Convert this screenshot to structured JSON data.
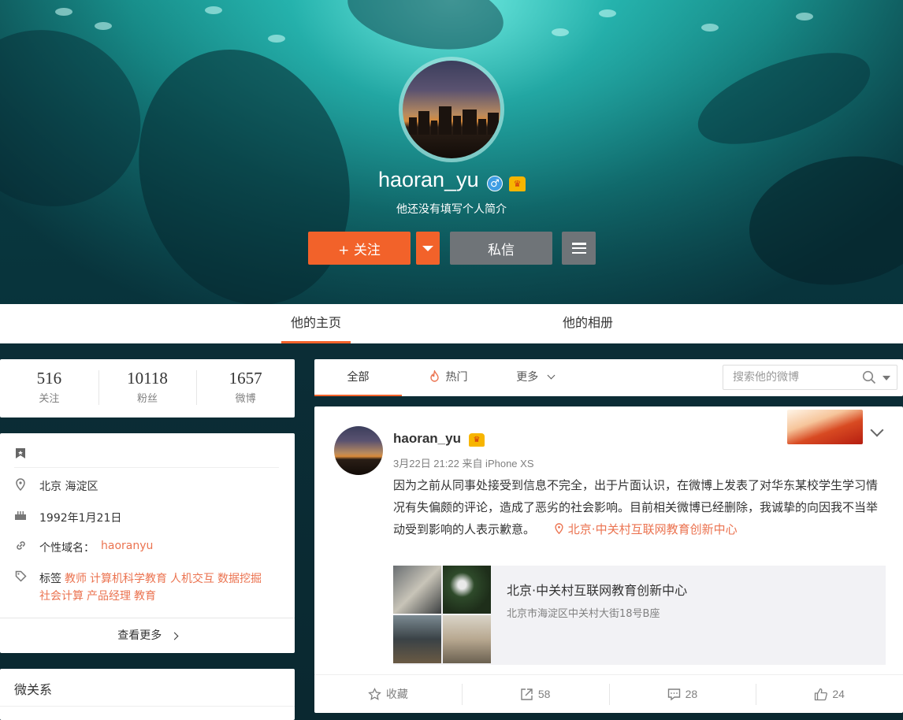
{
  "profile": {
    "username": "haoran_yu",
    "gender_icon": "male-icon",
    "vip_icon": "vip-crown-icon",
    "bio": "他还没有填写个人简介",
    "follow_label": "+ 关注",
    "message_label": "私信"
  },
  "main_tabs": [
    {
      "label": "他的主页",
      "active": true
    },
    {
      "label": "他的相册",
      "active": false
    }
  ],
  "stats": [
    {
      "value": "516",
      "label": "关注"
    },
    {
      "value": "10118",
      "label": "粉丝"
    },
    {
      "value": "1657",
      "label": "微博"
    }
  ],
  "info": {
    "location": "北京 海淀区",
    "birthday": "1992年1月21日",
    "domain_label": "个性域名：",
    "domain_value": "haoranyu",
    "tags_label": "标签",
    "tags": [
      "教师",
      "计算机科学教育",
      "人机交互",
      "数据挖掘",
      "社会计算",
      "产品经理",
      "教育"
    ],
    "more_label": "查看更多"
  },
  "relations": {
    "title": "微关系"
  },
  "feed_tabs": {
    "all": "全部",
    "hot": "热门",
    "more": "更多",
    "search_placeholder": "搜索他的微博"
  },
  "post": {
    "author": "haoran_yu",
    "meta": "3月22日 21:22 来自 iPhone XS",
    "text": "因为之前从同事处接受到信息不完全，出于片面认识，在微博上发表了对华东某校学生学习情况有失偏颇的评论，造成了恶劣的社会影响。目前相关微博已经删除，我诚挚的向因我不当举动受到影响的人表示歉意。",
    "location_tag": "北京·中关村互联网教育创新中心",
    "place": {
      "name": "北京·中关村互联网教育创新中心",
      "address": "北京市海淀区中关村大街18号B座"
    },
    "actions": {
      "favorite": "收藏",
      "repost": "58",
      "comment": "28",
      "like": "24"
    }
  },
  "colors": {
    "accent": "#f2622a",
    "link": "#eb7350",
    "secondary_button": "#6f7478"
  }
}
